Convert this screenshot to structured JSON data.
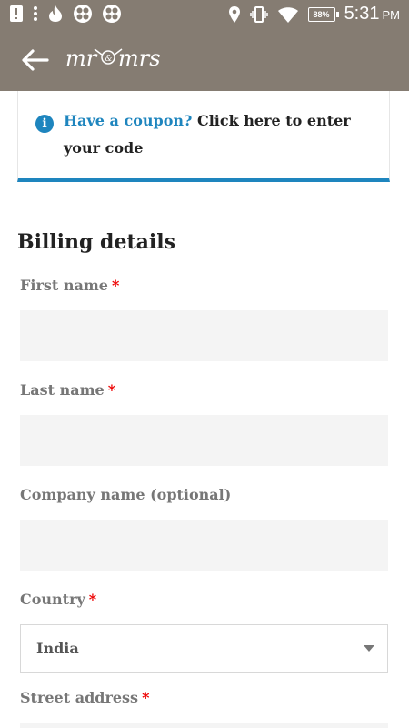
{
  "status_bar": {
    "time": "5:31",
    "meridiem": "PM",
    "battery": "88%",
    "icons_left": [
      "alert-icon",
      "overflow-dots-icon",
      "tinder-flame-icon",
      "grid-app-icon",
      "grid-app-icon"
    ],
    "icons_right": [
      "location-icon",
      "vibrate-icon",
      "wifi-icon",
      "battery-icon"
    ]
  },
  "app_bar": {
    "logo": "mr & mrs",
    "back_icon": "back-arrow-icon",
    "bar_color": "#857c72"
  },
  "coupon_notice": {
    "prompt": "Have a coupon?",
    "link": "Click here to enter your code",
    "accent_color": "#1e85be"
  },
  "billing": {
    "title": "Billing details",
    "fields": [
      {
        "label": "First name",
        "required": "*",
        "value": ""
      },
      {
        "label": "Last name",
        "required": "*",
        "value": ""
      },
      {
        "label": "Company name (optional)",
        "value": ""
      },
      {
        "label": "Country",
        "required": "*",
        "value": "India"
      },
      {
        "label": "Street address",
        "required": "*",
        "value": ""
      }
    ]
  }
}
